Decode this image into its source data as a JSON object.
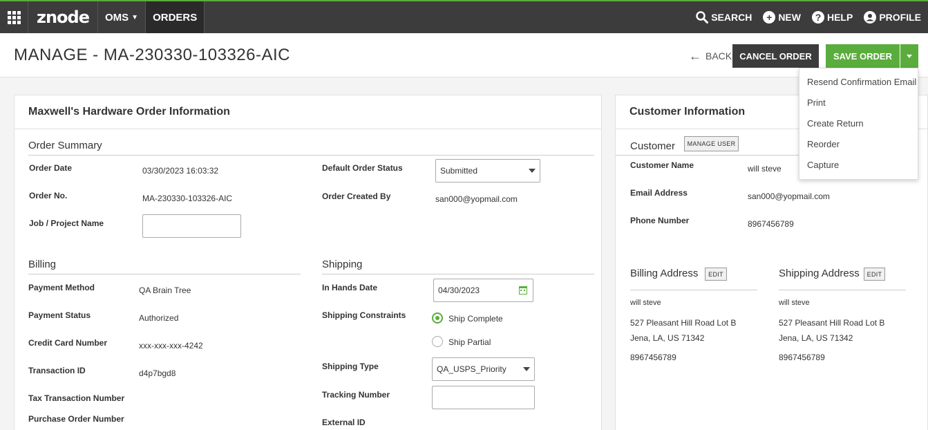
{
  "nav": {
    "logo": "znode",
    "oms": "OMS",
    "orders": "ORDERS",
    "search": "SEARCH",
    "new": "NEW",
    "help": "HELP",
    "profile": "PROFILE"
  },
  "header": {
    "title": "MANAGE - MA-230330-103326-AIC",
    "back": "BACK",
    "cancel": "CANCEL ORDER",
    "save": "SAVE ORDER"
  },
  "dropdown": [
    "Resend Confirmation Email",
    "Print",
    "Create Return",
    "Reorder",
    "Capture"
  ],
  "order_panel": {
    "title": "Maxwell's Hardware Order Information",
    "summary_title": "Order Summary",
    "order_date_label": "Order Date",
    "order_date": "03/30/2023 16:03:32",
    "order_no_label": "Order No.",
    "order_no": "MA-230330-103326-AIC",
    "job_label": "Job / Project Name",
    "job_value": "",
    "default_status_label": "Default Order Status",
    "default_status": "Submitted",
    "created_by_label": "Order Created By",
    "created_by": "san000@yopmail.com",
    "billing_title": "Billing",
    "payment_method_label": "Payment Method",
    "payment_method": "QA Brain Tree",
    "payment_status_label": "Payment Status",
    "payment_status": "Authorized",
    "cc_label": "Credit Card Number",
    "cc": "xxx-xxx-xxx-4242",
    "txn_label": "Transaction ID",
    "txn": "d4p7bgd8",
    "tax_txn_label": "Tax Transaction Number",
    "po_label": "Purchase Order Number",
    "shipping_title": "Shipping",
    "in_hands_label": "In Hands Date",
    "in_hands": "04/30/2023",
    "constraints_label": "Shipping Constraints",
    "ship_complete": "Ship Complete",
    "ship_partial": "Ship Partial",
    "ship_type_label": "Shipping Type",
    "ship_type": "QA_USPS_Priority",
    "tracking_label": "Tracking Number",
    "external_id_label": "External ID"
  },
  "customer_panel": {
    "title": "Customer Information",
    "customer_title": "Customer",
    "manage_user": "MANAGE USER",
    "name_label": "Customer Name",
    "name": "will steve",
    "email_label": "Email Address",
    "email": "san000@yopmail.com",
    "phone_label": "Phone Number",
    "phone": "8967456789",
    "billing_title": "Billing Address",
    "shipping_title": "Shipping Address",
    "edit": "EDIT",
    "billing": {
      "name": "will steve",
      "line1": "527 Pleasant Hill Road Lot B",
      "line2": "Jena,  LA,  US  71342",
      "phone": "8967456789"
    },
    "shipping": {
      "name": "will steve",
      "line1": "527 Pleasant Hill Road Lot B",
      "line2": "Jena,  LA,  US  71342",
      "phone": "8967456789"
    }
  }
}
